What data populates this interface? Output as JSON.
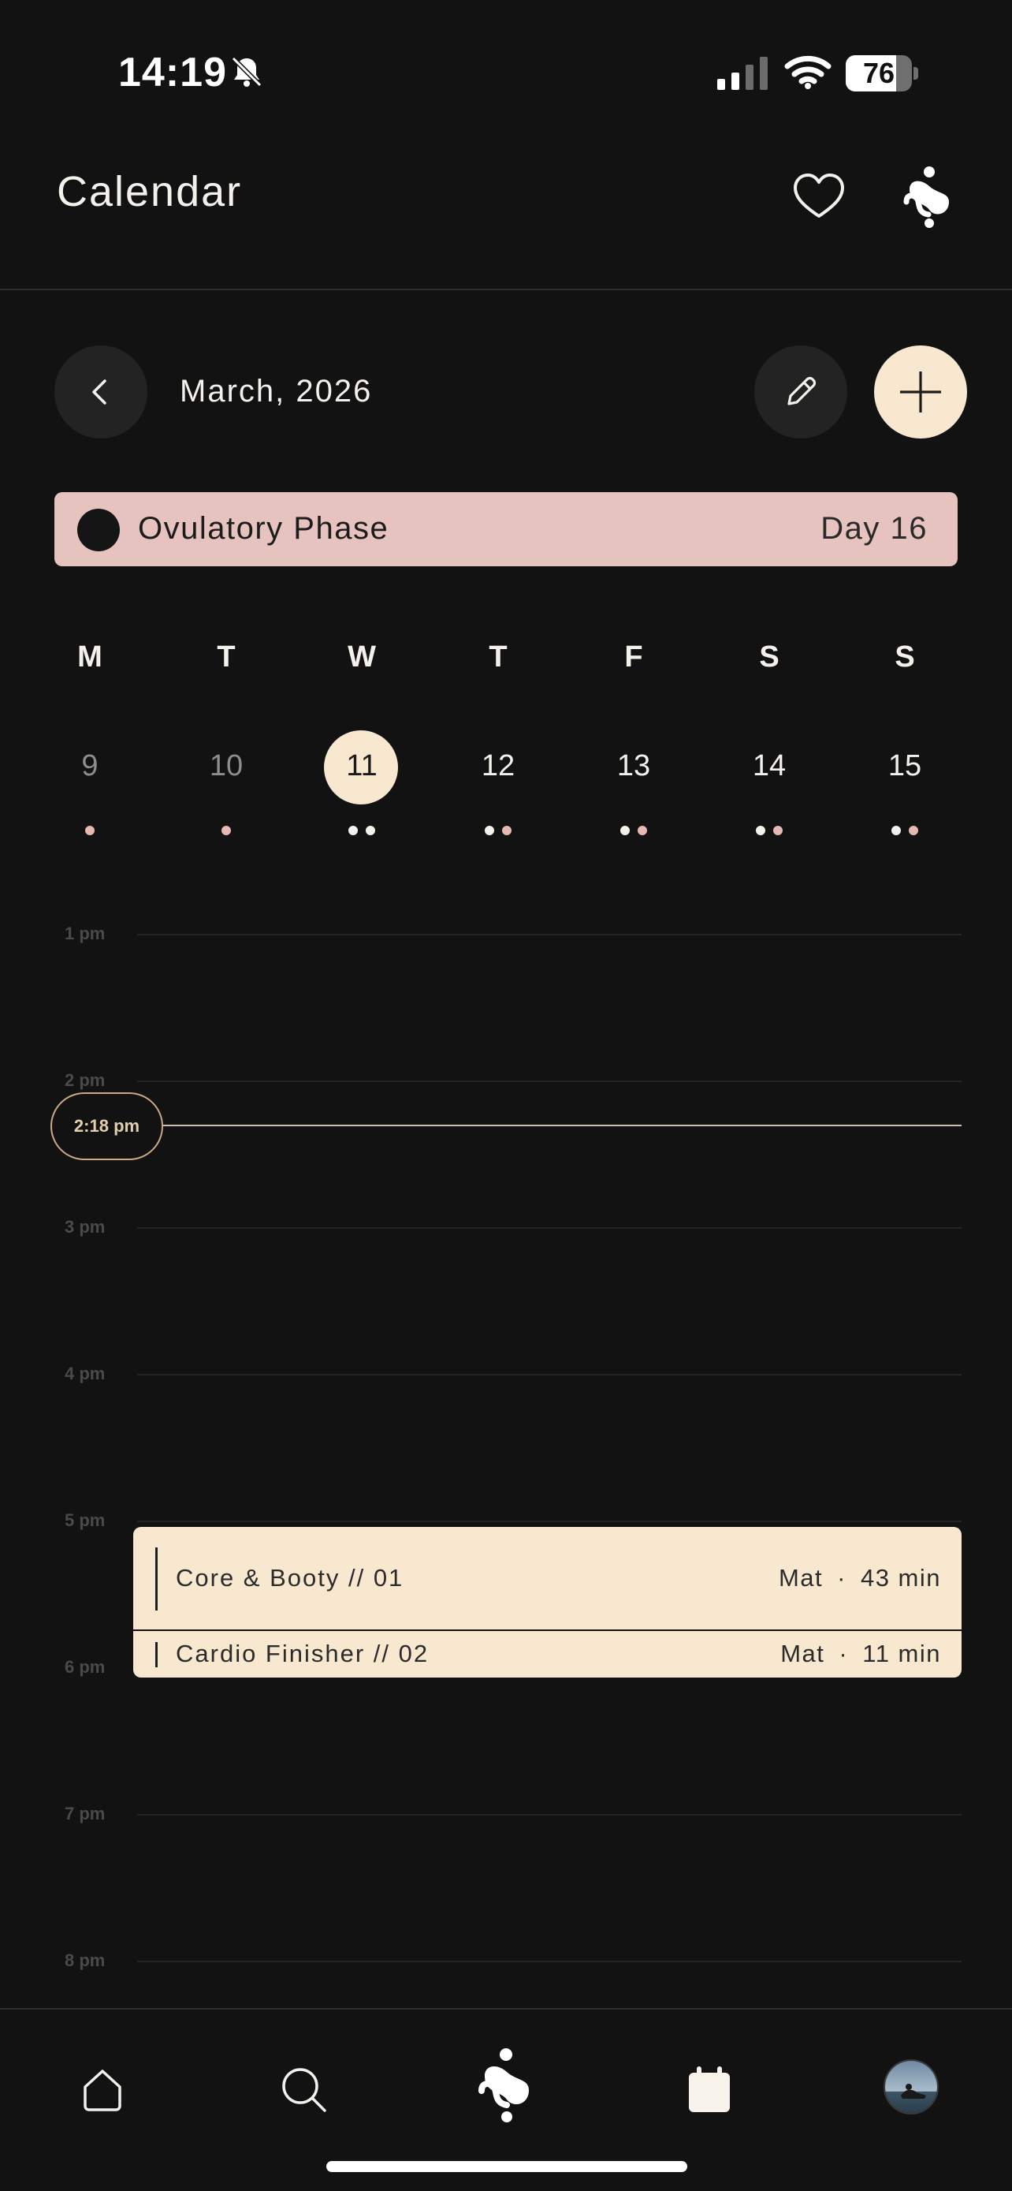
{
  "status_bar": {
    "time": "14:19",
    "battery": "76",
    "battery_level": 0.76
  },
  "header": {
    "title": "Calendar",
    "icons": [
      "heart-icon",
      "brand-logo-icon"
    ]
  },
  "calendar": {
    "month_label": "March, 2026",
    "phase": {
      "name": "Ovulatory Phase",
      "day": "Day 16",
      "color": "#e7c3c0"
    },
    "weekdays": [
      "M",
      "T",
      "W",
      "T",
      "F",
      "S",
      "S"
    ],
    "days": [
      {
        "num": "9",
        "state": "past",
        "dots": [
          "p"
        ]
      },
      {
        "num": "10",
        "state": "past",
        "dots": [
          "p"
        ]
      },
      {
        "num": "11",
        "state": "today",
        "dots": [
          "w",
          "w"
        ]
      },
      {
        "num": "12",
        "state": "future",
        "dots": [
          "w",
          "p"
        ]
      },
      {
        "num": "13",
        "state": "future",
        "dots": [
          "w",
          "p"
        ]
      },
      {
        "num": "14",
        "state": "future",
        "dots": [
          "w",
          "p"
        ]
      },
      {
        "num": "15",
        "state": "future",
        "dots": [
          "w",
          "p"
        ]
      }
    ]
  },
  "timeline": {
    "hours": [
      "1 pm",
      "2 pm",
      "3 pm",
      "4 pm",
      "5 pm",
      "6 pm",
      "7 pm",
      "8 pm"
    ],
    "now_label": "2:18 pm",
    "events": [
      {
        "title": "Core & Booty // 01",
        "equipment": "Mat",
        "duration": "43 min"
      },
      {
        "title": "Cardio Finisher // 02",
        "equipment": "Mat",
        "duration": "11 min"
      }
    ],
    "meta_separator": "·"
  },
  "colors": {
    "background": "#121212",
    "accent_cream": "#f7e8cf",
    "phase_pink": "#e7c3c0",
    "dot_pink": "#e8b8b2"
  },
  "bottom_nav": {
    "items": [
      "home-icon",
      "search-icon",
      "brand-logo-icon",
      "calendar-icon",
      "avatar"
    ]
  }
}
